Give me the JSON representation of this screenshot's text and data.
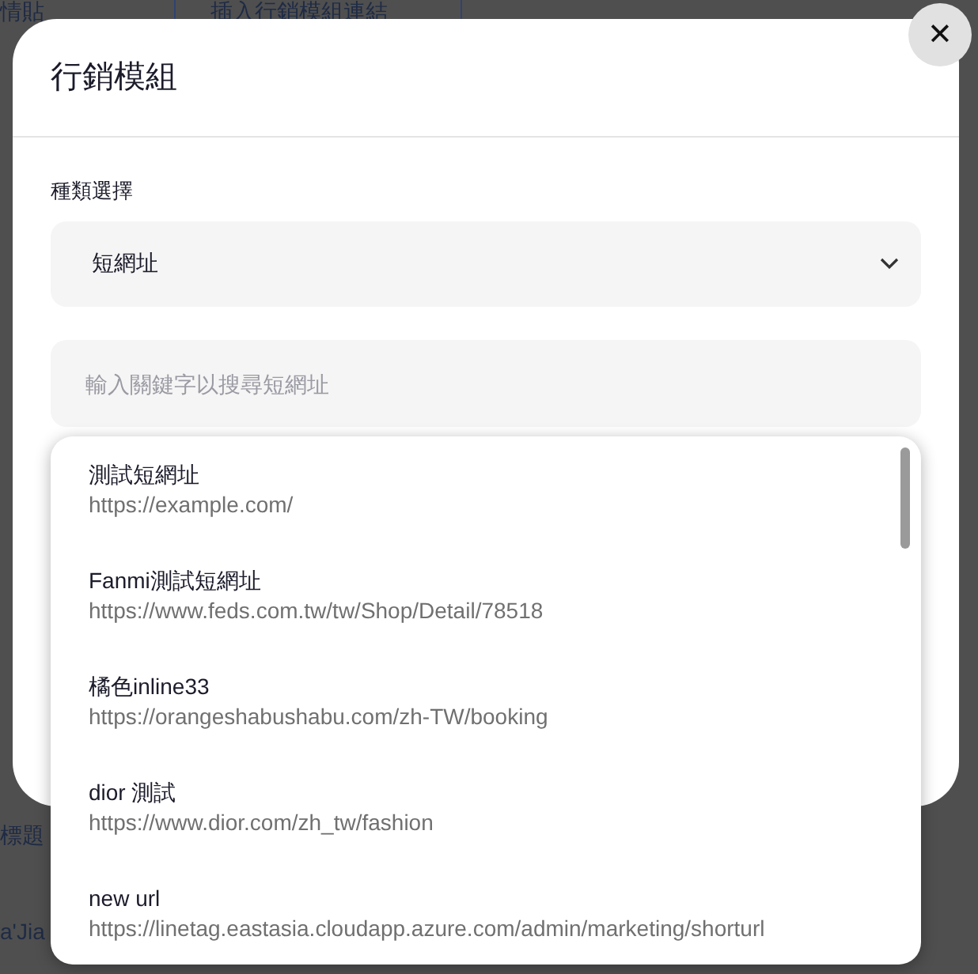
{
  "background": {
    "tabs": [
      {
        "label": "情貼"
      },
      {
        "label": "插入行銷模組連結"
      }
    ],
    "fragments": [
      {
        "text": "標題",
        "kind": "row"
      },
      {
        "text": "a'Jia",
        "kind": "row"
      }
    ]
  },
  "dialog": {
    "title": "行銷模組",
    "close": "✕",
    "type_label": "種類選擇",
    "type_value": "短網址",
    "search": {
      "placeholder": "輸入關鍵字以搜尋短網址"
    },
    "results": [
      {
        "name": "測試短網址",
        "url": "https://example.com/"
      },
      {
        "name": "Fanmi測試短網址",
        "url": "https://www.feds.com.tw/tw/Shop/Detail/78518"
      },
      {
        "name": "橘色inline33",
        "url": "https://orangeshabushabu.com/zh-TW/booking"
      },
      {
        "name": "dior 測試",
        "url": "https://www.dior.com/zh_tw/fashion"
      },
      {
        "name": "new url",
        "url": "https://linetag.eastasia.cloudapp.azure.com/admin/marketing/shorturl"
      }
    ]
  }
}
